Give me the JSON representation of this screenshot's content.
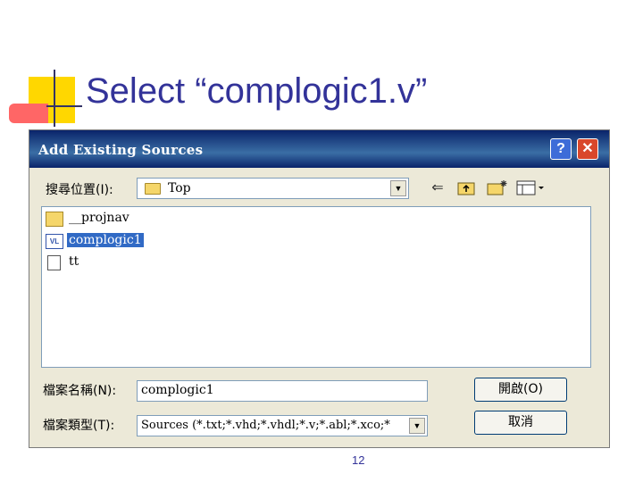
{
  "slide": {
    "title": "Select “complogic1.v”",
    "page_number": "12"
  },
  "dialog": {
    "title": "Add Existing Sources",
    "help_label": "?",
    "close_label": "✕",
    "look_in_label": "搜尋位置(I):",
    "look_in_value": "Top",
    "toolbar_icons": [
      "back-arrow-icon",
      "up-folder-icon",
      "new-folder-icon",
      "view-menu-icon"
    ],
    "files": [
      {
        "name": "__projnav",
        "icon": "folder-icon",
        "selected": false
      },
      {
        "name": "complogic1",
        "icon": "verilog-file-icon",
        "selected": true
      },
      {
        "name": "tt",
        "icon": "test-file-icon",
        "selected": false
      }
    ],
    "file_name_label": "檔案名稱(N):",
    "file_name_value": "complogic1",
    "file_type_label": "檔案類型(T):",
    "file_type_value": "Sources (*.txt;*.vhd;*.vhdl;*.v;*.abl;*.xco;*",
    "open_label": "開啟(O)",
    "cancel_label": "取消"
  },
  "colors": {
    "titlebar": "#0a246a",
    "slide_title": "#333399",
    "selection": "#316ac5",
    "close_button": "#d9472b",
    "help_button": "#3d6cd8"
  }
}
